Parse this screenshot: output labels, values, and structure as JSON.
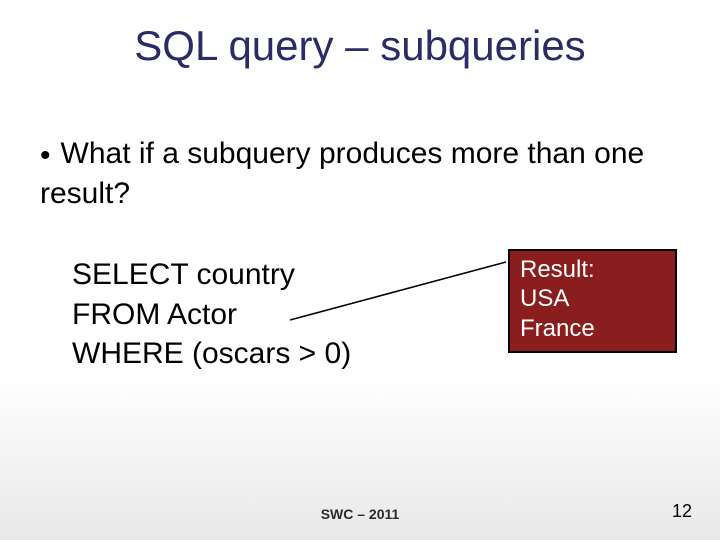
{
  "slide": {
    "title": "SQL query – subqueries",
    "bullet": "What if a subquery produces more than one result?",
    "sql": {
      "line1": "SELECT country",
      "line2": "FROM Actor",
      "line3": "WHERE (oscars > 0)"
    },
    "result": {
      "heading": "Result:",
      "row1": "USA",
      "row2": "France"
    },
    "footer": "SWC – 2011",
    "page_number": "12"
  }
}
